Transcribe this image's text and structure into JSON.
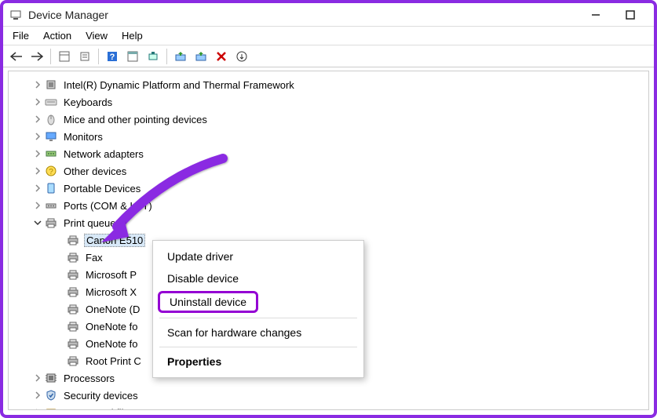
{
  "title": "Device Manager",
  "menu": {
    "file": "File",
    "action": "Action",
    "view": "View",
    "help": "Help"
  },
  "tree": {
    "items": [
      {
        "label": "Intel(R) Dynamic Platform and Thermal Framework",
        "icon": "chip"
      },
      {
        "label": "Keyboards",
        "icon": "keyboard"
      },
      {
        "label": "Mice and other pointing devices",
        "icon": "mouse"
      },
      {
        "label": "Monitors",
        "icon": "monitor"
      },
      {
        "label": "Network adapters",
        "icon": "network"
      },
      {
        "label": "Other devices",
        "icon": "other"
      },
      {
        "label": "Portable Devices",
        "icon": "portable"
      },
      {
        "label": "Ports (COM & LPT)",
        "icon": "port"
      }
    ],
    "printqueues": {
      "label": "Print queues",
      "children": [
        {
          "label": "Canon E510"
        },
        {
          "label": "Fax"
        },
        {
          "label": "Microsoft P"
        },
        {
          "label": "Microsoft X"
        },
        {
          "label": "OneNote (D"
        },
        {
          "label": "OneNote fo"
        },
        {
          "label": "OneNote fo"
        },
        {
          "label": "Root Print C"
        }
      ]
    },
    "after": [
      {
        "label": "Processors",
        "icon": "cpu"
      },
      {
        "label": "Security devices",
        "icon": "security"
      },
      {
        "label": "Smart card filters",
        "icon": "smartcard"
      }
    ]
  },
  "ctx": {
    "update": "Update driver",
    "disable": "Disable device",
    "uninstall": "Uninstall device",
    "scan": "Scan for hardware changes",
    "properties": "Properties"
  }
}
